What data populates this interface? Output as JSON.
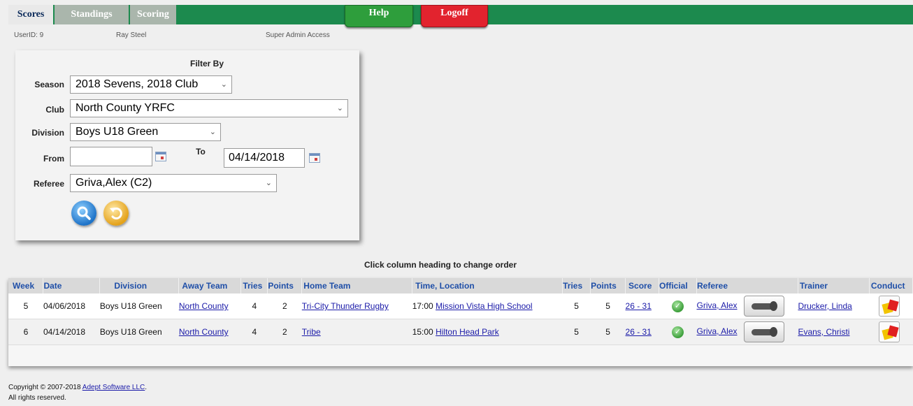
{
  "nav": {
    "tabs": [
      {
        "label": "Scores",
        "active": true
      },
      {
        "label": "Standings",
        "active": false
      },
      {
        "label": "Scoring",
        "active": false
      }
    ],
    "help_label": "Help",
    "logoff_label": "Logoff"
  },
  "user": {
    "id_text": "UserID: 9",
    "name": "Ray Steel",
    "access": "Super Admin Access"
  },
  "filter": {
    "title": "Filter By",
    "season": {
      "label": "Season",
      "value": "2018 Sevens, 2018 Club"
    },
    "club": {
      "label": "Club",
      "value": "North County YRFC"
    },
    "division": {
      "label": "Division",
      "value": "Boys U18 Green"
    },
    "from": {
      "label": "From",
      "value": ""
    },
    "to": {
      "label": "To",
      "value": "04/14/2018"
    },
    "referee": {
      "label": "Referee",
      "value": "Griva,Alex (C2)"
    }
  },
  "table": {
    "hint": "Click column heading to change order",
    "headers": [
      "Week",
      "Date",
      "Division",
      "Away Team",
      "Tries",
      "Points",
      "Home Team",
      "Time, Location",
      "Tries",
      "Points",
      "Score",
      "Official",
      "Referee",
      "Trainer",
      "Conduct"
    ],
    "rows": [
      {
        "week": "5",
        "date": "04/06/2018",
        "division": "Boys U18 Green",
        "away_team": "North County",
        "away_tries": "4",
        "away_points": "2",
        "home_team": "Tri-City Thunder Rugby",
        "time": "17:00",
        "location": "Mission Vista High School",
        "home_tries": "5",
        "home_points": "5",
        "score": "26 - 31",
        "referee": "Griva, Alex",
        "trainer": "Drucker, Linda"
      },
      {
        "week": "6",
        "date": "04/14/2018",
        "division": "Boys U18 Green",
        "away_team": "North County",
        "away_tries": "4",
        "away_points": "2",
        "home_team": "Tribe",
        "time": "15:00",
        "location": "Hilton Head Park",
        "home_tries": "5",
        "home_points": "5",
        "score": "26 - 31",
        "referee": "Griva, Alex",
        "trainer": "Evans, Christi"
      }
    ]
  },
  "footer": {
    "copyright_prefix": "Copyright © 2007-2018 ",
    "company_link": "Adept Software LLC",
    "copyright_suffix": ".",
    "rights": "All rights reserved."
  },
  "colors": {
    "topbar": "#1c8a4e",
    "help": "#2e9e3c",
    "logoff": "#e2232e",
    "header_text": "#1f4fa8"
  },
  "icons": {
    "search": "magnifier-icon",
    "reset": "undo-arrow-icon",
    "official": "check-circle-icon",
    "referee_action": "whistle-icon",
    "conduct": "penalty-cards-icon",
    "calendar": "calendar-icon",
    "dropdown": "chevron-down-icon"
  }
}
